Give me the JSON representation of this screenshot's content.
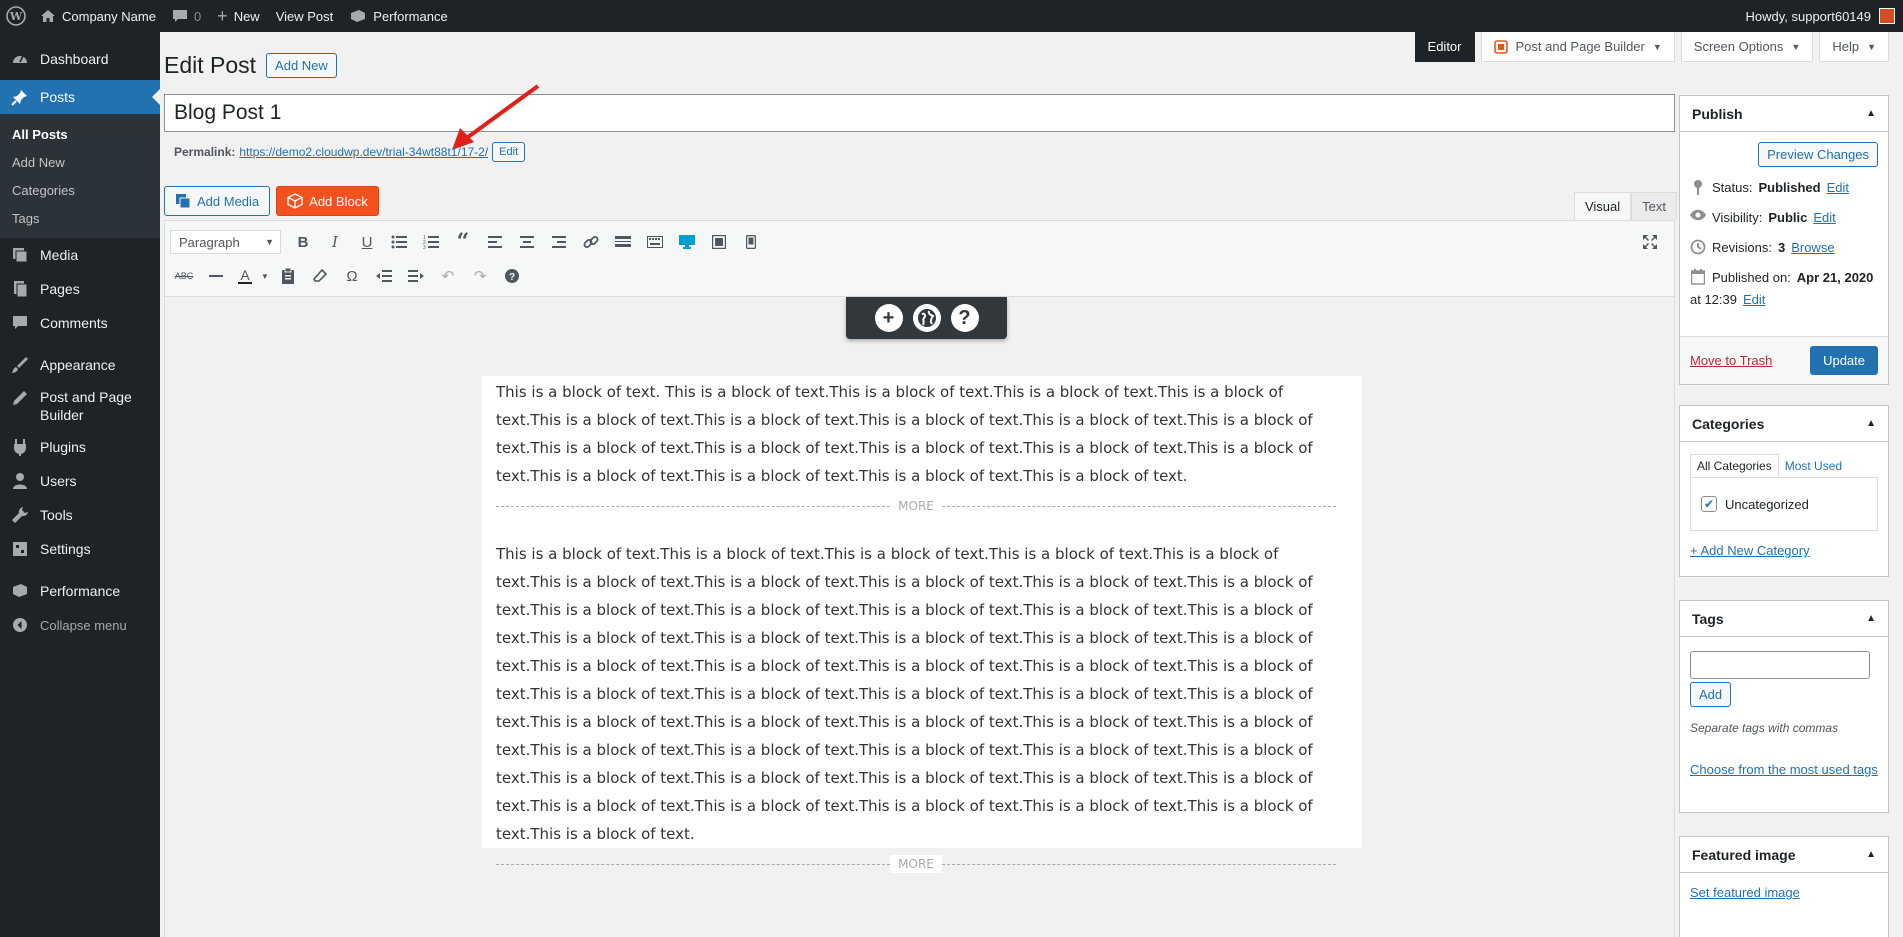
{
  "adminbar": {
    "site_name": "Company Name",
    "comments_count": "0",
    "new_label": "New",
    "view_post_label": "View Post",
    "performance_label": "Performance",
    "howdy": "Howdy, support60149"
  },
  "sidebar": {
    "items": [
      {
        "label": "Dashboard",
        "icon": "dashboard-icon"
      },
      {
        "label": "Posts",
        "icon": "pin-icon"
      },
      {
        "label": "Media",
        "icon": "media-icon"
      },
      {
        "label": "Pages",
        "icon": "pages-icon"
      },
      {
        "label": "Comments",
        "icon": "comments-icon"
      },
      {
        "label": "Appearance",
        "icon": "brush-icon"
      },
      {
        "label": "Post and Page Builder",
        "icon": "pencil-icon"
      },
      {
        "label": "Plugins",
        "icon": "plugin-icon"
      },
      {
        "label": "Users",
        "icon": "users-icon"
      },
      {
        "label": "Tools",
        "icon": "wrench-icon"
      },
      {
        "label": "Settings",
        "icon": "settings-icon"
      },
      {
        "label": "Performance",
        "icon": "performance-icon"
      }
    ],
    "submenu": [
      "All Posts",
      "Add New",
      "Categories",
      "Tags"
    ],
    "collapse": "Collapse menu"
  },
  "screen_tabs": {
    "editor": "Editor",
    "builder": "Post and Page Builder",
    "screen_options": "Screen Options",
    "help": "Help"
  },
  "heading": {
    "title": "Edit Post",
    "add_new": "Add New"
  },
  "post": {
    "title": "Blog Post 1",
    "permalink_label": "Permalink:",
    "permalink_url": "https://demo2.cloudwp.dev/trial-34wt88t1/17-2/",
    "permalink_edit": "Edit"
  },
  "media": {
    "add_media": "Add Media",
    "add_block": "Add Block"
  },
  "editor_tabs": {
    "visual": "Visual",
    "text": "Text"
  },
  "toolbar": {
    "format": "Paragraph"
  },
  "content": {
    "para1": "This is a block of text. This is a block of text.This is a block of text.This is a block of text.This is a block of text.This is a block of text.This is a block of text.This is a block of text.This is a block of text.This is a block of text.This is a block of text.This is a block of text.This is a block of text.This is a block of text.This is a block of text.This is a block of text.This is a block of text.This is a block of text.This is a block of text.",
    "more1": "MORE",
    "para2": "This is a block of text.This is a block of text.This is a block of text.This is a block of text.This is a block of text.This is a block of text.This is a block of text.This is a block of text.This is a block of text.This is a block of text.This is a block of text.This is a block of text.This is a block of text.This is a block of text.This is a block of text.This is a block of text.This is a block of text.This is a block of text.This is a block of text.This is a block of text.This is a block of text.This is a block of text.This is a block of text.This is a block of text.This is a block of text.This is a block of text.This is a block of text.This is a block of text.This is a block of text.This is a block of text.This is a block of text.This is a block of text.This is a block of text.This is a block of text.This is a block of text.This is a block of text.This is a block of text.This is a block of text.This is a block of text.This is a block of text.This is a block of text.This is a block of text.This is a block of text.This is a block of text.This is a block of text.This is a block of text.This is a block of text.This is a block of text.This is a block of text.This is a block of text.This is a block of text.",
    "more2": "MORE"
  },
  "publish": {
    "title": "Publish",
    "preview": "Preview Changes",
    "status_label": "Status:",
    "status_value": "Published",
    "visibility_label": "Visibility:",
    "visibility_value": "Public",
    "revisions_label": "Revisions:",
    "revisions_value": "3",
    "browse": "Browse",
    "published_on_label": "Published on:",
    "published_on_value": "Apr 21, 2020",
    "published_at": "at 12:39",
    "edit": "Edit",
    "trash": "Move to Trash",
    "update": "Update"
  },
  "categories": {
    "title": "Categories",
    "tab_all": "All Categories",
    "tab_used": "Most Used",
    "item": "Uncategorized",
    "add_new": "+ Add New Category"
  },
  "tags": {
    "title": "Tags",
    "add": "Add",
    "hint": "Separate tags with commas",
    "choose": "Choose from the most used tags"
  },
  "featured": {
    "title": "Featured image",
    "set": "Set featured image"
  }
}
